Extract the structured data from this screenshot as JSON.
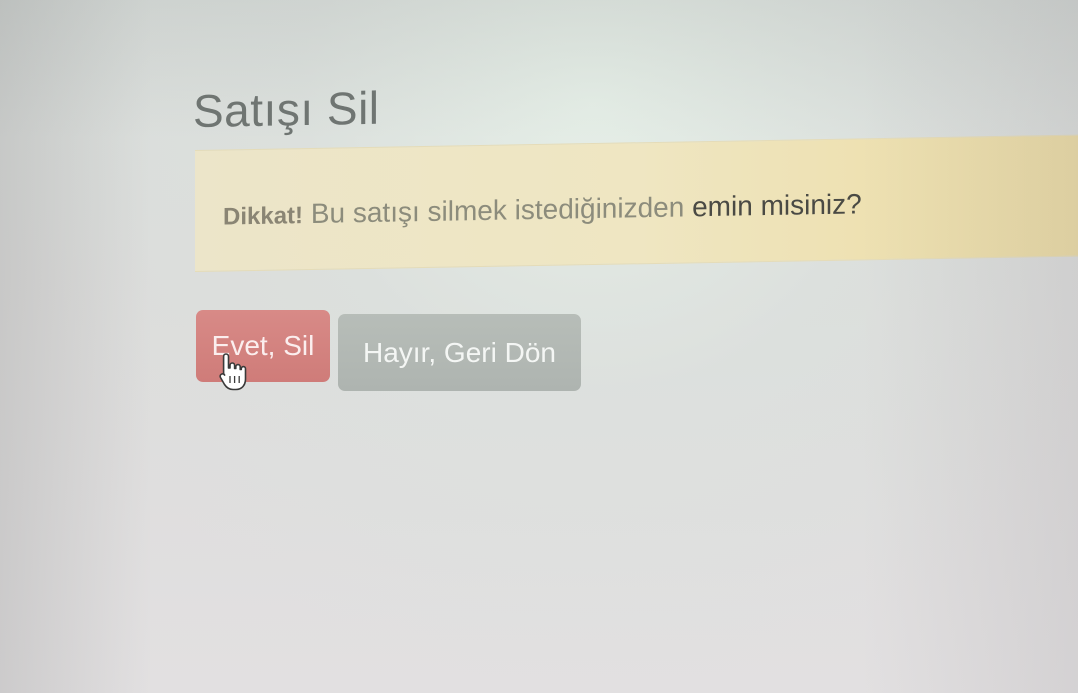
{
  "page": {
    "title": "Satışı Sil"
  },
  "alert": {
    "strong": "Dikkat!",
    "message_light": "Bu satışı silmek istediğinizden",
    "message_dark": "emin misiniz?",
    "background_color": "#efe6c2"
  },
  "actions": {
    "confirm_label": "Evet, Sil",
    "cancel_label": "Hayır, Geri Dön",
    "confirm_color": "#d9534f",
    "cancel_color": "#aeb4b0"
  },
  "cursor": {
    "icon": "hand-pointer-icon"
  }
}
